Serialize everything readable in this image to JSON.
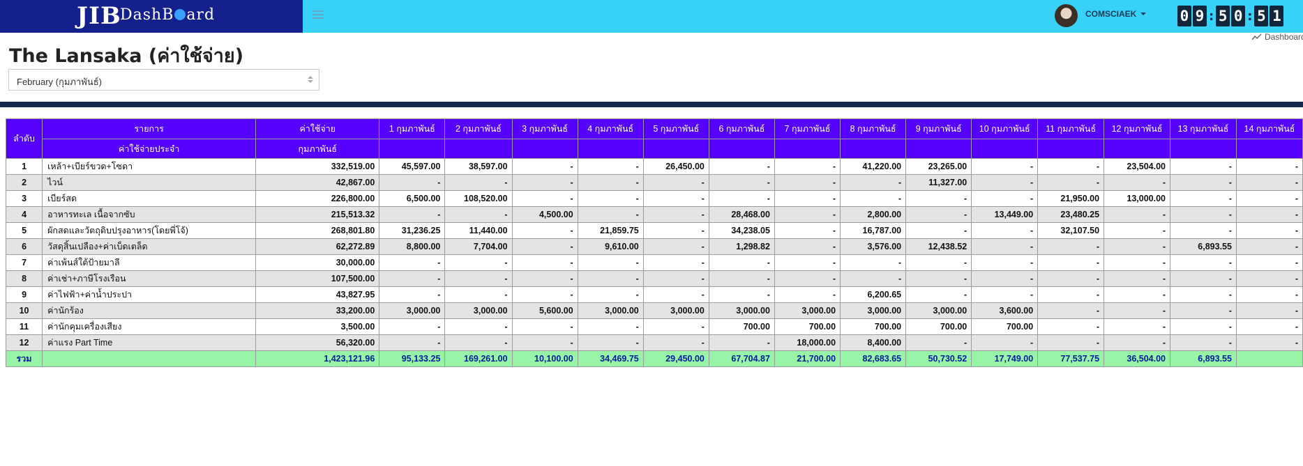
{
  "header": {
    "brand_logo": "JIB",
    "brand_name_pre": "DashB",
    "brand_name_post": "ard",
    "username": "COMSCIAEK",
    "clock": [
      "0",
      "9",
      "5",
      "0",
      "5",
      "1"
    ]
  },
  "breadcrumb": "Dashboard",
  "page_title": "The Lansaka (ค่าใช้จ่าย)",
  "month_select": {
    "value": "February (กุมภาพันธ์)"
  },
  "colors": {
    "brand": "#14218c",
    "topbar": "#38d2f9",
    "table_header": "#5500ff",
    "total_row": "#98f5a8"
  },
  "table": {
    "header_idx": "ลำดับ",
    "header_item_top": "รายการ",
    "header_item_bottom": "ค่าใช้จ่ายประจำ",
    "header_cost_top": "ค่าใช้จ่าย",
    "header_cost_bottom": "กุมภาพันธ์",
    "day_headers": [
      "1 กุมภาพันธ์",
      "2 กุมภาพันธ์",
      "3 กุมภาพันธ์",
      "4 กุมภาพันธ์",
      "5 กุมภาพันธ์",
      "6 กุมภาพันธ์",
      "7 กุมภาพันธ์",
      "8 กุมภาพันธ์",
      "9 กุมภาพันธ์",
      "10 กุมภาพันธ์",
      "11 กุมภาพันธ์",
      "12 กุมภาพันธ์",
      "13 กุมภาพันธ์",
      "14 กุมภาพันธ์"
    ],
    "rows": [
      {
        "idx": "1",
        "name": "เหล้า+เบียร์ขวด+โซดา",
        "total": "332,519.00",
        "days": [
          "45,597.00",
          "38,597.00",
          "-",
          "-",
          "26,450.00",
          "-",
          "-",
          "41,220.00",
          "23,265.00",
          "-",
          "-",
          "23,504.00",
          "-",
          "-"
        ]
      },
      {
        "idx": "2",
        "name": "ไวน์",
        "total": "42,867.00",
        "days": [
          "-",
          "-",
          "-",
          "-",
          "-",
          "-",
          "-",
          "-",
          "11,327.00",
          "-",
          "-",
          "-",
          "-",
          "-"
        ]
      },
      {
        "idx": "3",
        "name": "เบียร์สด",
        "total": "226,800.00",
        "days": [
          "6,500.00",
          "108,520.00",
          "-",
          "-",
          "-",
          "-",
          "-",
          "-",
          "-",
          "-",
          "21,950.00",
          "13,000.00",
          "-",
          "-"
        ]
      },
      {
        "idx": "4",
        "name": "อาหารทะเล เนื้อจากซับ",
        "total": "215,513.32",
        "days": [
          "-",
          "-",
          "4,500.00",
          "-",
          "-",
          "28,468.00",
          "-",
          "2,800.00",
          "-",
          "13,449.00",
          "23,480.25",
          "-",
          "-",
          "-"
        ]
      },
      {
        "idx": "5",
        "name": "ผักสดและวัตถุดิบปรุงอาหาร(โดยพี่โจ้)",
        "total": "268,801.80",
        "days": [
          "31,236.25",
          "11,440.00",
          "-",
          "21,859.75",
          "-",
          "34,238.05",
          "-",
          "16,787.00",
          "-",
          "-",
          "32,107.50",
          "-",
          "-",
          "-"
        ]
      },
      {
        "idx": "6",
        "name": "วัสดุสิ้นเปลือง+ค่าเบ็ดเตล็ด",
        "total": "62,272.89",
        "days": [
          "8,800.00",
          "7,704.00",
          "-",
          "9,610.00",
          "-",
          "1,298.82",
          "-",
          "3,576.00",
          "12,438.52",
          "-",
          "-",
          "-",
          "6,893.55",
          "-"
        ]
      },
      {
        "idx": "7",
        "name": "ค่าเพ้นส์ใต้ป้ายมาลี",
        "total": "30,000.00",
        "days": [
          "-",
          "-",
          "-",
          "-",
          "-",
          "-",
          "-",
          "-",
          "-",
          "-",
          "-",
          "-",
          "-",
          "-"
        ]
      },
      {
        "idx": "8",
        "name": "ค่าเช่า+ภาษีโรงเรือน",
        "total": "107,500.00",
        "days": [
          "-",
          "-",
          "-",
          "-",
          "-",
          "-",
          "-",
          "-",
          "-",
          "-",
          "-",
          "-",
          "-",
          "-"
        ]
      },
      {
        "idx": "9",
        "name": "ค่าไฟฟ้า+ค่าน้ำประปา",
        "total": "43,827.95",
        "days": [
          "-",
          "-",
          "-",
          "-",
          "-",
          "-",
          "-",
          "6,200.65",
          "-",
          "-",
          "-",
          "-",
          "-",
          "-"
        ]
      },
      {
        "idx": "10",
        "name": "ค่านักร้อง",
        "total": "33,200.00",
        "days": [
          "3,000.00",
          "3,000.00",
          "5,600.00",
          "3,000.00",
          "3,000.00",
          "3,000.00",
          "3,000.00",
          "3,000.00",
          "3,000.00",
          "3,600.00",
          "-",
          "-",
          "-",
          "-"
        ]
      },
      {
        "idx": "11",
        "name": "ค่านักคุมเครื่องเสียง",
        "total": "3,500.00",
        "days": [
          "-",
          "-",
          "-",
          "-",
          "-",
          "700.00",
          "700.00",
          "700.00",
          "700.00",
          "700.00",
          "-",
          "-",
          "-",
          "-"
        ]
      },
      {
        "idx": "12",
        "name": "ค่าแรง Part Time",
        "total": "56,320.00",
        "days": [
          "-",
          "-",
          "-",
          "-",
          "-",
          "-",
          "18,000.00",
          "8,400.00",
          "-",
          "-",
          "-",
          "-",
          "-",
          "-"
        ]
      }
    ],
    "total_row": {
      "label": "รวม",
      "total": "1,423,121.96",
      "days": [
        "95,133.25",
        "169,261.00",
        "10,100.00",
        "34,469.75",
        "29,450.00",
        "67,704.87",
        "21,700.00",
        "82,683.65",
        "50,730.52",
        "17,749.00",
        "77,537.75",
        "36,504.00",
        "6,893.55",
        ""
      ]
    }
  }
}
